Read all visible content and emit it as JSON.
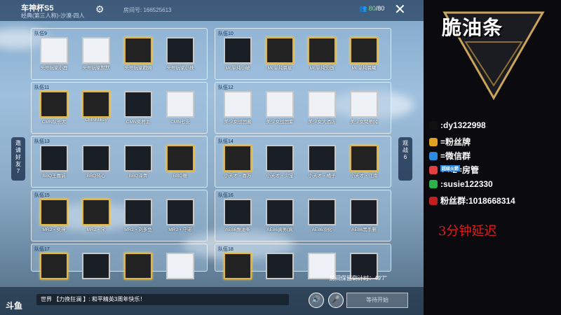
{
  "room": {
    "title": "车神杯S5",
    "subtitle": "经典(第三人称)-沙漠-四人",
    "room_id": "房间号: 166525613",
    "player_count": "80",
    "player_max": "/80"
  },
  "teams": [
    {
      "label": "队伍9",
      "players": [
        "头号玩家小鹿",
        "头号玩家默默",
        "头号玩家戳姆",
        "头号玩家小珠"
      ]
    },
    {
      "label": "队伍10",
      "players": [
        "Mc单纯小破",
        "Mc单纯晨星",
        "Mc单纯安画",
        "Mc单纯晨曦"
      ]
    },
    {
      "label": "队伍11",
      "players": [
        "CMN队长犬",
        "CMNMikey",
        "CMN奕君主",
        "CMN七安"
      ]
    },
    {
      "label": "队伍12",
      "players": [
        "美少女战团酱",
        "美少女战团紫",
        "美少女大酒店",
        "美少女梵蒂冈"
      ]
    },
    {
      "label": "队伍13",
      "players": [
        "BBQ王嘉诚",
        "BBQ热心",
        "BBQ泽青",
        "BBQ暖"
      ]
    },
    {
      "label": "队伍14",
      "players": [
        "小天才・喜万",
        "小天才・少宝",
        "小天才・橘子",
        "小天才・江南"
      ]
    },
    {
      "label": "队伍15",
      "players": [
        "MR2・奕神",
        "MR2・宋",
        "MR2・刘多鱼",
        "MR2・守诺"
      ]
    },
    {
      "label": "队伍16",
      "players": [
        "AE86脆油条",
        "AE86真男(真",
        "AE86羽化",
        "AE86黑手删"
      ]
    },
    {
      "label": "队伍17",
      "players": [
        "",
        "",
        "",
        ""
      ]
    },
    {
      "label": "队伍18",
      "players": [
        "",
        "",
        "",
        ""
      ]
    }
  ],
  "side": {
    "invite": "邀请好友7",
    "watch": "观战6"
  },
  "chat": {
    "text": "世界 【力挽狂澜 】: 和平精英3周年快乐！"
  },
  "countdown": "房间保留倒计时：49'7\"",
  "start_label": "等待开始",
  "logo_text": "斗鱼",
  "stream": {
    "brand": "脆油条",
    "lines": [
      {
        "icon": "tiktok-icon",
        "color": "#111111",
        "text": ":dy1322998"
      },
      {
        "icon": "fan-badge-icon",
        "color": "#e0a020",
        "text": "=粉丝牌"
      },
      {
        "icon": "wechat-group-icon",
        "color": "#2a8be0",
        "text": "=微信群"
      },
      {
        "icon": "rocket-icon",
        "color": "#e04040",
        "text": "+      ×2=房管"
      },
      {
        "icon": "wechat-icon",
        "color": "#2bb24c",
        "text": ":susie122330"
      },
      {
        "icon": "fan-group-icon",
        "color": "#c02020",
        "text": "粉丝群:1018668314"
      }
    ],
    "sub_label": "超级火箭",
    "delay": "3分钟延迟"
  },
  "colors": {
    "accent": "#e3b53c",
    "delay_red": "#e01c1c",
    "count_green": "#7ee07a"
  }
}
